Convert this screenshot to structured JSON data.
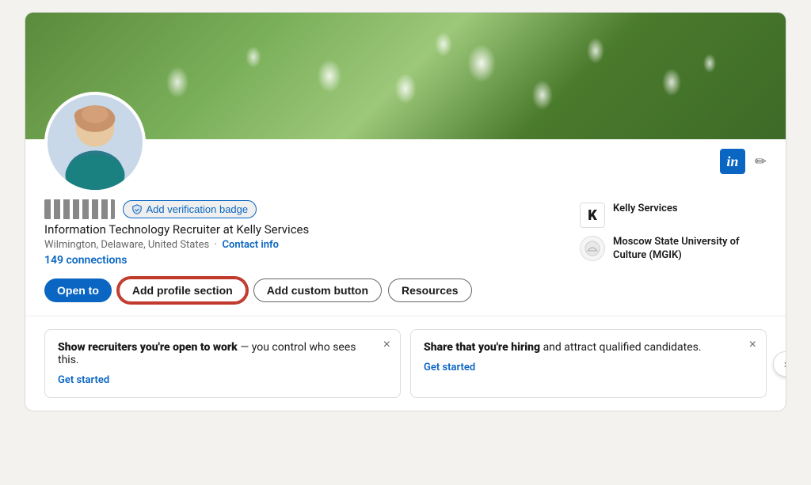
{
  "card": {
    "banner_alt": "Green foliage with white flowers"
  },
  "profile": {
    "name_display": "·tml ·.·t·s",
    "verification_badge_label": "Add verification badge",
    "headline": "Information Technology Recruiter at Kelly Services",
    "location": "Wilmington, Delaware, United States",
    "contact_info_label": "Contact info",
    "connections": "149 connections"
  },
  "action_buttons": {
    "open_to_label": "Open to",
    "add_profile_section_label": "Add profile section",
    "add_custom_button_label": "Add custom button",
    "resources_label": "Resources"
  },
  "companies": [
    {
      "logo_text": "K",
      "logo_type": "square",
      "name": "Kelly Services"
    },
    {
      "logo_text": "🏛",
      "logo_type": "circle",
      "name": "Moscow State University of Culture (MGIK)"
    }
  ],
  "info_cards": [
    {
      "title_bold": "Show recruiters you're open to work",
      "title_dash": " — you control who sees this.",
      "body": "",
      "link_label": "Get started"
    },
    {
      "title_bold": "Share that you're hiring",
      "title_dash": " and attract qualified candidates.",
      "body": "",
      "link_label": "Get started"
    }
  ],
  "icons": {
    "linkedin_in": "in",
    "edit": "✏",
    "close": "×",
    "next": "›",
    "shield": "🛡"
  }
}
